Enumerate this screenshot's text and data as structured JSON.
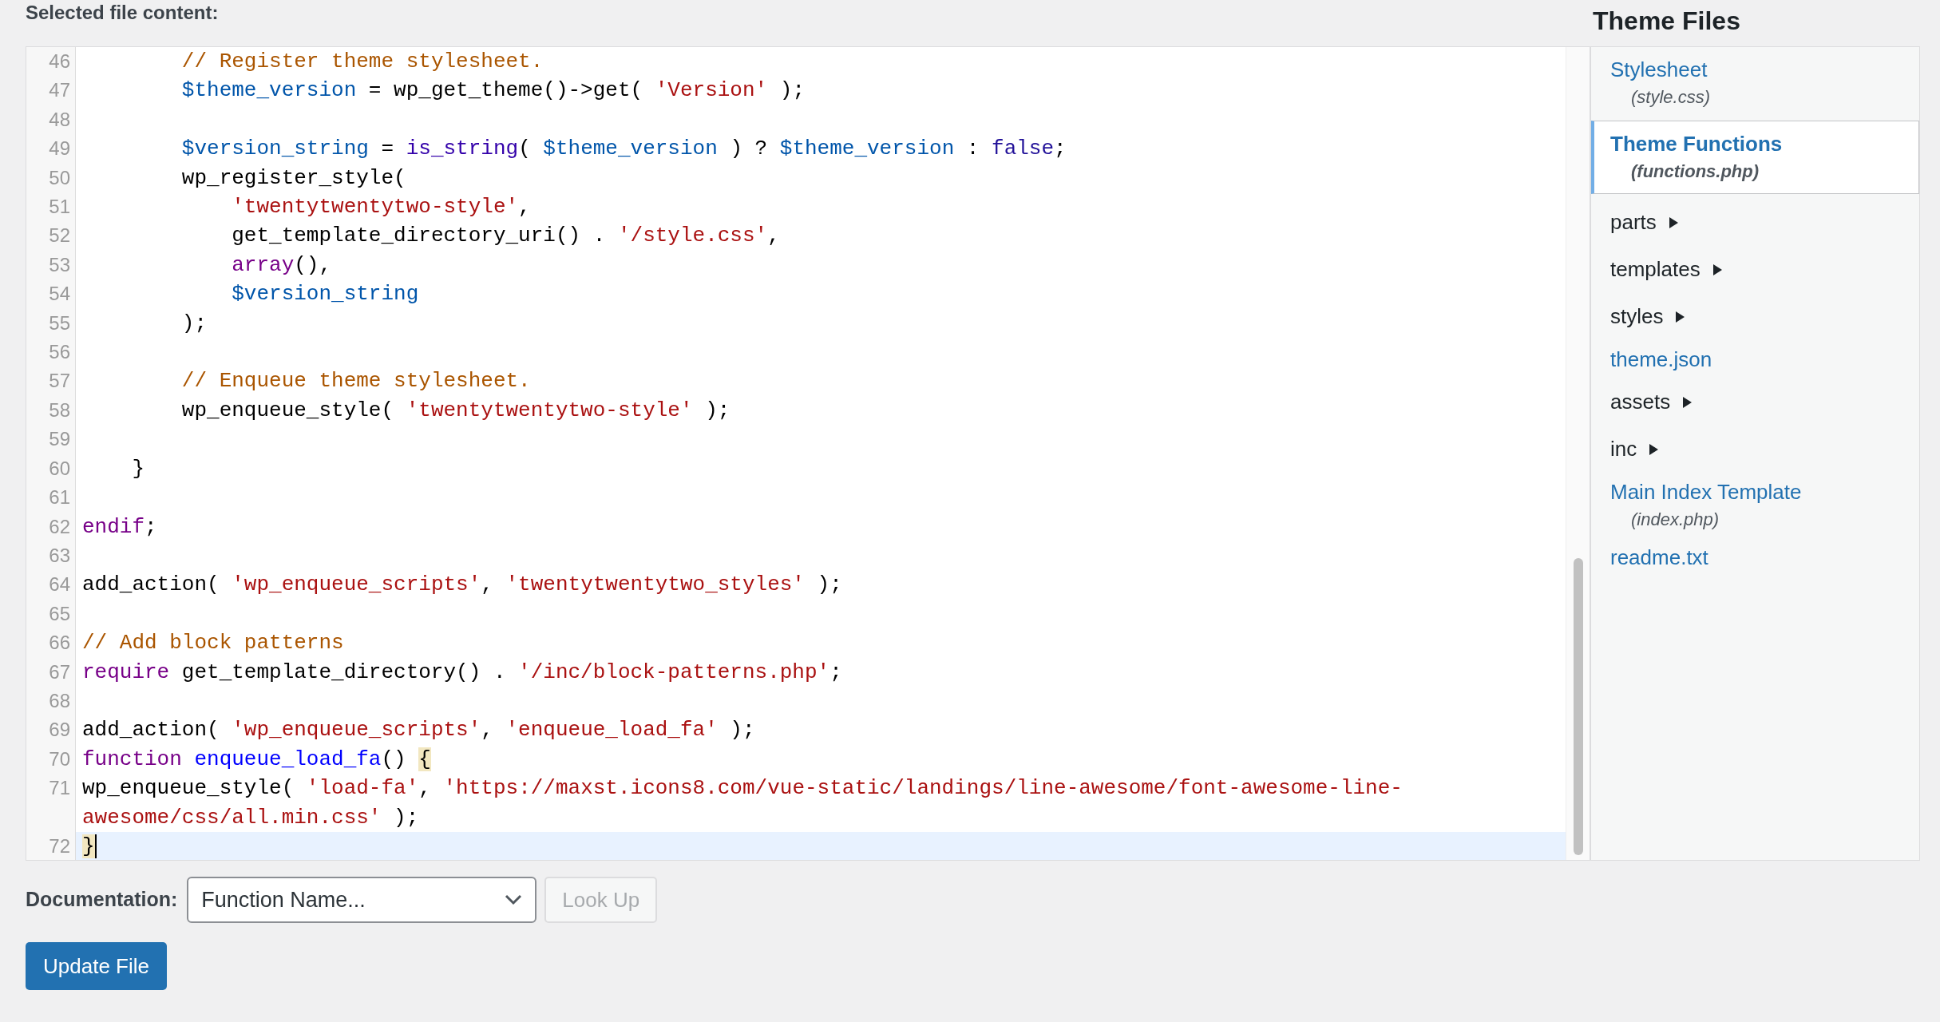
{
  "editor": {
    "heading": "Selected file content:",
    "lines": [
      {
        "number": "46",
        "active": false,
        "tokens": [
          {
            "kind": "comment",
            "text": "        // Register theme stylesheet."
          }
        ]
      },
      {
        "number": "47",
        "active": false,
        "tokens": [
          {
            "kind": "variable",
            "text": "        $theme_version"
          },
          {
            "kind": "plain",
            "text": " = wp_get_theme()->get( "
          },
          {
            "kind": "string",
            "text": "'Version'"
          },
          {
            "kind": "plain",
            "text": " );"
          }
        ]
      },
      {
        "number": "48",
        "active": false
      },
      {
        "number": "49",
        "active": false,
        "tokens": [
          {
            "kind": "variable",
            "text": "        $version_string"
          },
          {
            "kind": "plain",
            "text": " = "
          },
          {
            "kind": "builtin",
            "text": "is_string"
          },
          {
            "kind": "plain",
            "text": "( "
          },
          {
            "kind": "variable",
            "text": "$theme_version"
          },
          {
            "kind": "plain",
            "text": " ) ? "
          },
          {
            "kind": "variable",
            "text": "$theme_version"
          },
          {
            "kind": "plain",
            "text": " : "
          },
          {
            "kind": "atom",
            "text": "false"
          },
          {
            "kind": "plain",
            "text": ";"
          }
        ]
      },
      {
        "number": "50",
        "active": false,
        "tokens": [
          {
            "kind": "plain",
            "text": "        wp_register_style("
          }
        ]
      },
      {
        "number": "51",
        "active": false,
        "tokens": [
          {
            "kind": "string",
            "text": "            'twentytwentytwo-style'"
          },
          {
            "kind": "plain",
            "text": ","
          }
        ]
      },
      {
        "number": "52",
        "active": false,
        "tokens": [
          {
            "kind": "plain",
            "text": "            get_template_directory_uri() . "
          },
          {
            "kind": "string",
            "text": "'/style.css'"
          },
          {
            "kind": "plain",
            "text": ","
          }
        ]
      },
      {
        "number": "53",
        "active": false,
        "tokens": [
          {
            "kind": "keyword",
            "text": "            array"
          },
          {
            "kind": "plain",
            "text": "(),"
          }
        ]
      },
      {
        "number": "54",
        "active": false,
        "tokens": [
          {
            "kind": "variable",
            "text": "            $version_string"
          }
        ]
      },
      {
        "number": "55",
        "active": false,
        "tokens": [
          {
            "kind": "plain",
            "text": "        );"
          }
        ]
      },
      {
        "number": "56",
        "active": false
      },
      {
        "number": "57",
        "active": false,
        "tokens": [
          {
            "kind": "comment",
            "text": "        // Enqueue theme stylesheet."
          }
        ]
      },
      {
        "number": "58",
        "active": false,
        "tokens": [
          {
            "kind": "plain",
            "text": "        wp_enqueue_style( "
          },
          {
            "kind": "string",
            "text": "'twentytwentytwo-style'"
          },
          {
            "kind": "plain",
            "text": " );"
          }
        ]
      },
      {
        "number": "59",
        "active": false
      },
      {
        "number": "60",
        "active": false,
        "tokens": [
          {
            "kind": "plain",
            "text": "    }"
          }
        ]
      },
      {
        "number": "61",
        "active": false
      },
      {
        "number": "62",
        "active": false,
        "tokens": [
          {
            "kind": "keyword",
            "text": "endif"
          },
          {
            "kind": "plain",
            "text": ";"
          }
        ]
      },
      {
        "number": "63",
        "active": false
      },
      {
        "number": "64",
        "active": false,
        "tokens": [
          {
            "kind": "plain",
            "text": "add_action( "
          },
          {
            "kind": "string",
            "text": "'wp_enqueue_scripts'"
          },
          {
            "kind": "plain",
            "text": ", "
          },
          {
            "kind": "string",
            "text": "'twentytwentytwo_styles'"
          },
          {
            "kind": "plain",
            "text": " );"
          }
        ]
      },
      {
        "number": "65",
        "active": false
      },
      {
        "number": "66",
        "active": false,
        "tokens": [
          {
            "kind": "comment",
            "text": "// Add block patterns"
          }
        ]
      },
      {
        "number": "67",
        "active": false,
        "tokens": [
          {
            "kind": "keyword",
            "text": "require"
          },
          {
            "kind": "plain",
            "text": " get_template_directory() . "
          },
          {
            "kind": "string",
            "text": "'/inc/block-patterns.php'"
          },
          {
            "kind": "plain",
            "text": ";"
          }
        ]
      },
      {
        "number": "68",
        "active": false
      },
      {
        "number": "69",
        "active": false,
        "tokens": [
          {
            "kind": "plain",
            "text": "add_action( "
          },
          {
            "kind": "string",
            "text": "'wp_enqueue_scripts'"
          },
          {
            "kind": "plain",
            "text": ", "
          },
          {
            "kind": "string",
            "text": "'enqueue_load_fa'"
          },
          {
            "kind": "plain",
            "text": " );"
          }
        ]
      },
      {
        "number": "70",
        "active": false,
        "tokens": [
          {
            "kind": "keyword",
            "text": "function "
          },
          {
            "kind": "def",
            "text": "enqueue_load_fa"
          },
          {
            "kind": "plain",
            "text": "() "
          },
          {
            "kind": "match",
            "text": "{"
          }
        ]
      },
      {
        "number": "71",
        "active": false,
        "tokens": [
          {
            "kind": "plain",
            "text": "wp_enqueue_style( "
          },
          {
            "kind": "string",
            "text": "'load-fa'"
          },
          {
            "kind": "plain",
            "text": ", "
          },
          {
            "kind": "string",
            "text": "'https://maxst.icons8.com/vue-static/landings/line-awesome/font-awesome-line-awesome/css/all.min.css'"
          },
          {
            "kind": "plain",
            "text": " );"
          }
        ]
      },
      {
        "number": "72",
        "active": true,
        "tokens": [
          {
            "kind": "match",
            "text": "}"
          }
        ]
      }
    ]
  },
  "sidebar": {
    "title": "Theme Files",
    "items": [
      {
        "kind": "file",
        "label": "Stylesheet",
        "filename": "(style.css)",
        "selected": false
      },
      {
        "kind": "file",
        "label": "Theme Functions",
        "filename": "(functions.php)",
        "selected": true
      },
      {
        "kind": "folder",
        "label": "parts",
        "expanded": false
      },
      {
        "kind": "folder",
        "label": "templates",
        "expanded": false
      },
      {
        "kind": "folder",
        "label": "styles",
        "expanded": false
      },
      {
        "kind": "file",
        "label": "theme.json",
        "selected": false
      },
      {
        "kind": "folder",
        "label": "assets",
        "expanded": false
      },
      {
        "kind": "folder",
        "label": "inc",
        "expanded": false
      },
      {
        "kind": "file",
        "label": "Main Index Template",
        "filename": "(index.php)",
        "selected": false
      },
      {
        "kind": "file",
        "label": "readme.txt",
        "selected": false
      }
    ]
  },
  "documentation": {
    "label": "Documentation:",
    "select": {
      "value": "Function Name..."
    },
    "lookup_button": {
      "label": "Look Up",
      "disabled": true
    }
  },
  "update_button": {
    "label": "Update File"
  }
}
